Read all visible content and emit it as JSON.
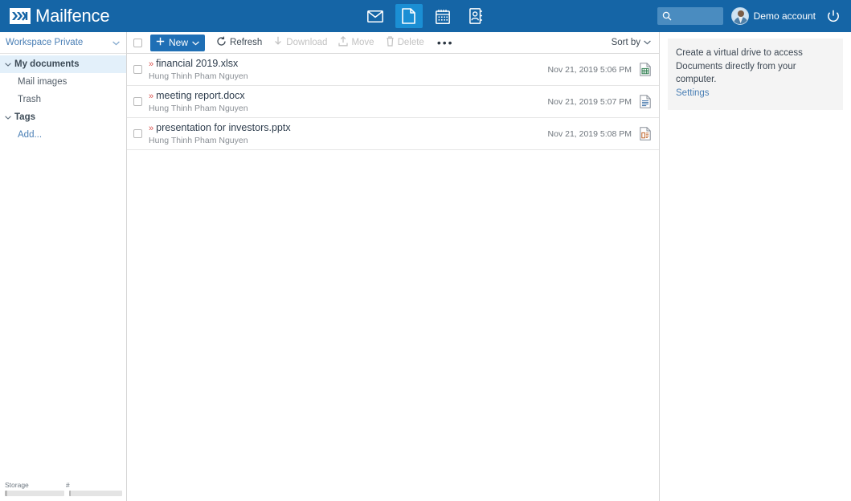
{
  "app": {
    "brand": "Mailfence",
    "brand_icon": "mailfence-logo-icon"
  },
  "topbar": {
    "nav": [
      {
        "name": "mail-icon",
        "label": "Mail",
        "active": false
      },
      {
        "name": "documents-icon",
        "label": "Documents",
        "active": true
      },
      {
        "name": "calendar-icon",
        "label": "Calendar",
        "active": false
      },
      {
        "name": "contacts-icon",
        "label": "Contacts",
        "active": false
      }
    ],
    "search": {
      "value": "",
      "placeholder": "",
      "icon": "search-icon"
    },
    "account": {
      "name": "Demo account",
      "avatar": "user-avatar"
    },
    "logout": {
      "icon": "power-icon",
      "label": "Logout"
    },
    "colors": {
      "bar": "#1565a6",
      "active_tab": "#1b8fd4",
      "search_bg": "#4a8cc0"
    }
  },
  "sidebar": {
    "workspace": {
      "label": "Workspace Private",
      "chevron": "chevron-down-icon"
    },
    "tree": [
      {
        "label": "My documents",
        "type": "group",
        "selected": true,
        "caret": "chevron-down-icon"
      },
      {
        "label": "Mail images",
        "type": "child",
        "selected": false
      },
      {
        "label": "Trash",
        "type": "child",
        "selected": false
      },
      {
        "label": "Tags",
        "type": "group",
        "selected": false,
        "caret": "chevron-down-icon"
      },
      {
        "label": "Add...",
        "type": "link",
        "selected": false
      }
    ],
    "storage": {
      "label_storage": "Storage",
      "label_count": "#",
      "storage_percent": 4,
      "count_percent": 3
    }
  },
  "toolbar": {
    "select_all": {
      "name": "select-all-checkbox",
      "checked": false
    },
    "new_label": "New",
    "new_plus": "plus-icon",
    "new_chevron": "chevron-down-icon",
    "items": [
      {
        "label": "Refresh",
        "icon": "refresh-icon",
        "disabled": false
      },
      {
        "label": "Download",
        "icon": "download-icon",
        "disabled": true
      },
      {
        "label": "Move",
        "icon": "move-icon",
        "disabled": true
      },
      {
        "label": "Delete",
        "icon": "trash-icon",
        "disabled": true
      }
    ],
    "more": "•••",
    "sort_by": "Sort by",
    "sort_chevron": "chevron-down-icon"
  },
  "files": [
    {
      "marker": "»",
      "name": "financial 2019.xlsx",
      "owner": "Hung Thinh Pham Nguyen",
      "date": "Nov 21, 2019 5:06 PM",
      "type_icon": "spreadsheet-file-icon"
    },
    {
      "marker": "»",
      "name": "meeting report.docx",
      "owner": "Hung Thinh Pham Nguyen",
      "date": "Nov 21, 2019 5:07 PM",
      "type_icon": "document-file-icon"
    },
    {
      "marker": "»",
      "name": "presentation for investors.pptx",
      "owner": "Hung Thinh Pham Nguyen",
      "date": "Nov 21, 2019 5:08 PM",
      "type_icon": "presentation-file-icon"
    }
  ],
  "right_panel": {
    "tip_line1": "Create a virtual drive to access",
    "tip_line2": "Documents directly from your computer.",
    "settings_link": "Settings"
  }
}
